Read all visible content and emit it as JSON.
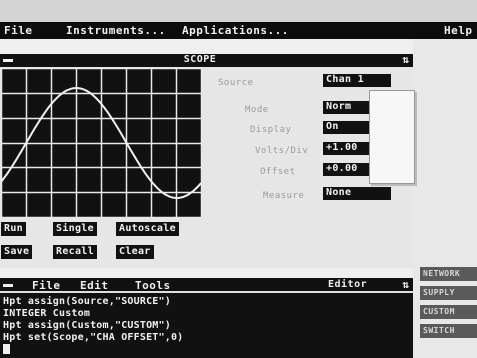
{
  "top_band": {
    "title": ""
  },
  "menubar": {
    "file": "File",
    "instruments": "Instruments...",
    "applications": "Applications...",
    "help": "Help"
  },
  "scope": {
    "title": "SCOPE",
    "arrows_glyph": "⇅",
    "waveform": {
      "type": "sine",
      "cycles": 1.0,
      "amplitude_divisions": 2.2
    },
    "grid": {
      "columns": 8,
      "rows": 6
    },
    "buttons": {
      "run": "Run",
      "single": "Single",
      "autoscale": "Autoscale",
      "save": "Save",
      "recall": "Recall",
      "clear": "Clear"
    },
    "params": {
      "source": {
        "label": "Source",
        "value": "Chan 1"
      },
      "mode": {
        "label": "Mode",
        "value": "Norm"
      },
      "display": {
        "label": "Display",
        "value": "On"
      },
      "volts_div": {
        "label": "Volts/Div",
        "value": "+1.00"
      },
      "offset": {
        "label": "Offset",
        "value": "+0.00"
      },
      "measure": {
        "label": "Measure",
        "value": "None"
      }
    },
    "popup_items": [
      "",
      "",
      "",
      "",
      "",
      "",
      ""
    ]
  },
  "side_buttons": [
    "NETWORK",
    "SUPPLY",
    "CUSTOM",
    "SWITCH"
  ],
  "editor": {
    "menu": {
      "file": "File",
      "edit": "Edit",
      "tools": "Tools"
    },
    "title": "Editor",
    "arrows_glyph": "⇅",
    "lines": [
      "Hpt assign(Source,\"SOURCE\")",
      "INTEGER Custom",
      "Hpt assign(Custom,\"CUSTOM\")",
      "Hpt set(Scope,\"CHA OFFSET\",0)"
    ]
  },
  "colors": {
    "bar_black": "#111111",
    "background": "#efefef",
    "label_gray": "#9a9a9a"
  }
}
